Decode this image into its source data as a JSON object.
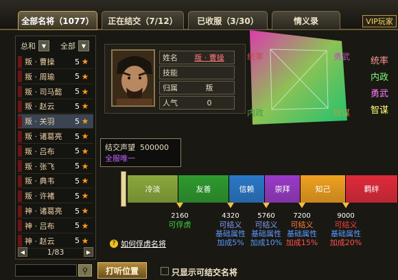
{
  "tabs": [
    {
      "label": "全部名将（1077）"
    },
    {
      "label": "正在结交（7/12）"
    },
    {
      "label": "已收服（3/30）"
    },
    {
      "label": "情义录"
    }
  ],
  "vip_label": "VIP玩家",
  "filters": {
    "left": "总和",
    "right": "全部"
  },
  "generals": [
    {
      "name": "叛 · 曹操",
      "level": "5"
    },
    {
      "name": "叛 · 周瑜",
      "level": "5"
    },
    {
      "name": "叛 · 司马懿",
      "level": "5"
    },
    {
      "name": "叛 · 赵云",
      "level": "5"
    },
    {
      "name": "叛 · 关羽",
      "level": "5"
    },
    {
      "name": "叛 · 诸葛亮",
      "level": "5"
    },
    {
      "name": "叛 · 吕布",
      "level": "5"
    },
    {
      "name": "叛 · 张飞",
      "level": "5"
    },
    {
      "name": "叛 · 典韦",
      "level": "5"
    },
    {
      "name": "叛 · 许褚",
      "level": "5"
    },
    {
      "name": "神 · 诸葛亮",
      "level": "5"
    },
    {
      "name": "神 · 吕布",
      "level": "5"
    },
    {
      "name": "神 · 赵云",
      "level": "5"
    }
  ],
  "pager": "1/83",
  "info": {
    "name_label": "姓名",
    "name_value": "叛 · 曹操",
    "skill_label": "技能",
    "skill_value": "",
    "belong_label": "归属",
    "belong_value": "叛",
    "popularity_label": "人气",
    "popularity_value": "0"
  },
  "radar_labels": {
    "top_left": "统率",
    "top_right": "勇武",
    "bottom_left": "内政",
    "bottom_right": "智谋"
  },
  "side_stats": [
    {
      "label": "统率",
      "color": "#ff9a9a"
    },
    {
      "label": "内政",
      "color": "#7cff7c"
    },
    {
      "label": "勇武",
      "color": "#ff7aff"
    },
    {
      "label": "智谋",
      "color": "#ffff7a"
    }
  ],
  "tooltip": {
    "label": "结交声望",
    "value": "500000",
    "note": "全服唯一"
  },
  "rep_bar": [
    {
      "label": "冷淡",
      "color": "#8aa83c"
    },
    {
      "label": "友善",
      "color": "#2e9a2e"
    },
    {
      "label": "信赖",
      "color": "#2a78c8"
    },
    {
      "label": "崇拜",
      "color": "#9a3ac8"
    },
    {
      "label": "知己",
      "color": "#f0a020"
    },
    {
      "label": "羁绊",
      "color": "#e02a3a"
    }
  ],
  "ticks": [
    "2160",
    "4320",
    "5760",
    "7200",
    "9000"
  ],
  "tick_desc": [
    {
      "l1": "可俘虏",
      "l2": "",
      "l3": ""
    },
    {
      "l1": "可结义",
      "l2": "基础属性",
      "l3": "加成5%"
    },
    {
      "l1": "可结义",
      "l2": "基础属性",
      "l3": "加成10%"
    },
    {
      "l1": "可结义",
      "l2": "基础属性",
      "l3": "加成15%"
    },
    {
      "l1": "可结义",
      "l2": "基础属性",
      "l3": "加成20%"
    }
  ],
  "help_link": "如何俘虏名将",
  "listen_button": "打听位置",
  "checkbox_label": "只显示可结交名将"
}
